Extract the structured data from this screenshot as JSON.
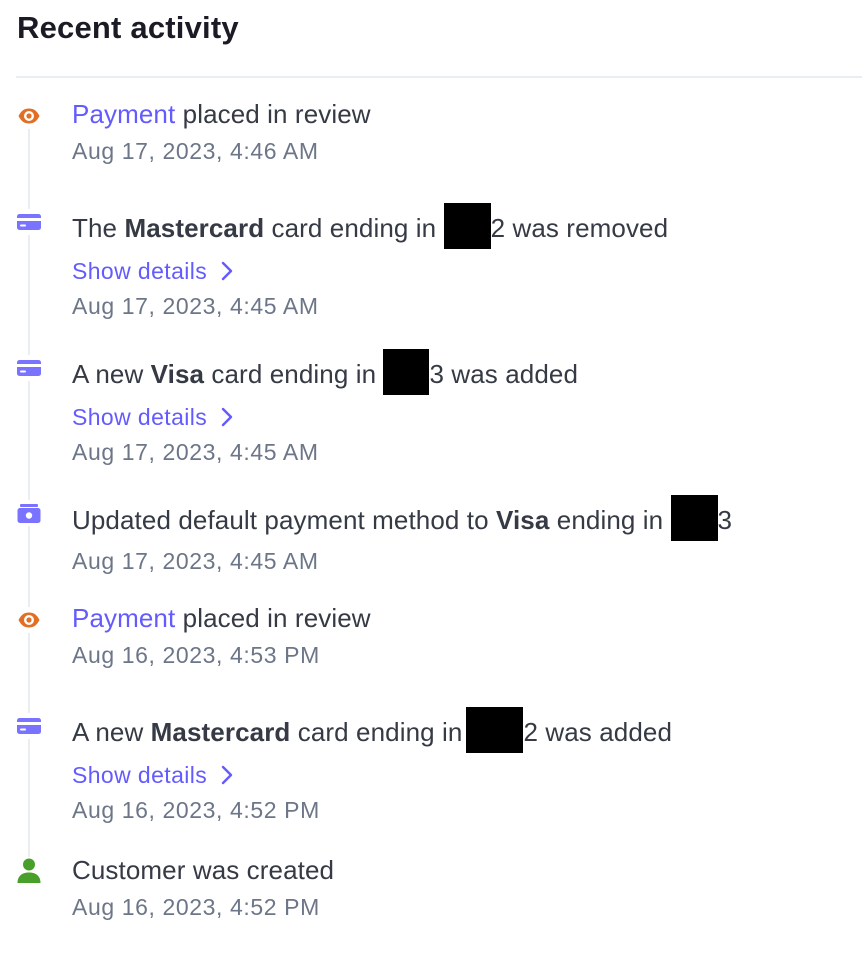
{
  "header": {
    "title": "Recent activity"
  },
  "colors": {
    "accent": "#635bff",
    "review_icon": "#e16f24",
    "card_icon": "#7a73ff",
    "customer_icon": "#48a02a",
    "text": "#353a44",
    "muted": "#6c7688"
  },
  "events": [
    {
      "icon": "eye-icon",
      "link": "Payment",
      "text": " placed in review",
      "time": "Aug 17, 2023, 4:46 AM"
    },
    {
      "icon": "credit-card-icon",
      "prefix": "The ",
      "brand": "Mastercard",
      "mid": " card ending in ",
      "last_digit": "2",
      "suffix": " was removed",
      "details": "Show details",
      "time": "Aug 17, 2023, 4:45 AM"
    },
    {
      "icon": "credit-card-icon",
      "prefix": "A new ",
      "brand": "Visa",
      "mid": " card ending in ",
      "last_digit": "3",
      "suffix": " was added",
      "details": "Show details",
      "time": "Aug 17, 2023, 4:45 AM"
    },
    {
      "icon": "wallet-icon",
      "prefix": "Updated default payment method to ",
      "brand": "Visa",
      "mid": " ending in ",
      "last_digit": "3",
      "time": "Aug 17, 2023, 4:45 AM"
    },
    {
      "icon": "eye-icon",
      "link": "Payment",
      "text": " placed in review",
      "time": "Aug 16, 2023, 4:53 PM"
    },
    {
      "icon": "credit-card-icon",
      "prefix": "A new ",
      "brand": "Mastercard",
      "mid": " card ending in",
      "last_digit": "2",
      "suffix": " was added",
      "details": "Show details",
      "time": "Aug 16, 2023, 4:52 PM"
    },
    {
      "icon": "user-icon",
      "text": "Customer was created",
      "time": "Aug 16, 2023, 4:52 PM"
    }
  ]
}
